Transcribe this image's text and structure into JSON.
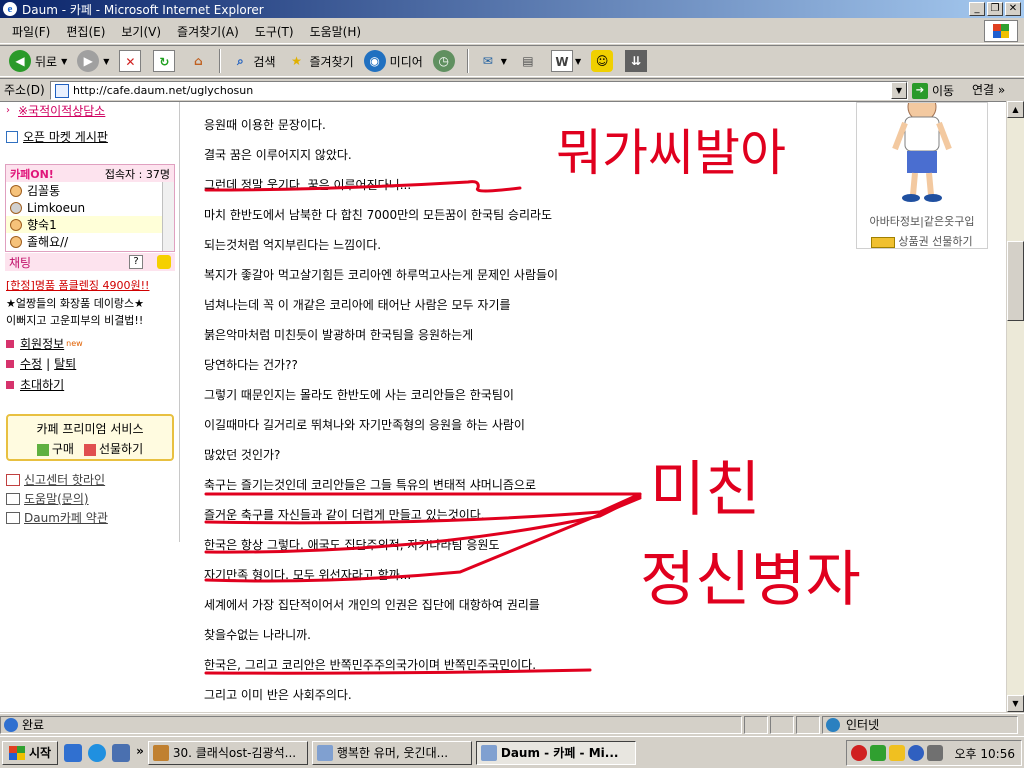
{
  "window": {
    "title": "Daum - 카페 - Microsoft Internet Explorer",
    "app_icon": "e"
  },
  "menu": [
    "파일(F)",
    "편집(E)",
    "보기(V)",
    "즐겨찾기(A)",
    "도구(T)",
    "도움말(H)"
  ],
  "toolbar": {
    "back": "뒤로",
    "search": "검색",
    "favorites": "즐겨찾기",
    "media": "미디어"
  },
  "address": {
    "label": "주소(D)",
    "url": "http://cafe.daum.net/uglychosun",
    "go": "이동",
    "links": "연결"
  },
  "sidebar": {
    "top_link": "※국적이적상담소",
    "open_market": "오픈 마켓 게시판",
    "cafe_on": {
      "label": "카페ON!",
      "visitors": "접속자 : 37명",
      "users": [
        "김꼴통",
        "Limkoeun",
        "향숙1",
        "졸해요//"
      ]
    },
    "chat": "채팅",
    "help_q": "?",
    "promo1": "[한정]명품 폼클렌징 4900원!!",
    "promo2": "★얼짱들의 화장품 데이랑스★",
    "promo3": "이뻐지고 고운피부의 비결법!!",
    "member_info": "회원정보",
    "new_tag": "new",
    "edit": "수정",
    "divider": "|",
    "leave": "탈퇴",
    "invite": "초대하기",
    "premium": {
      "title": "카페 프리미엄 서비스",
      "buy": "구매",
      "gift": "선물하기"
    },
    "report": "신고센터 핫라인",
    "help": "도움말(문의)",
    "terms": "Daum카페 약관"
  },
  "post_lines": [
    "응원때 이용한 문장이다.",
    "결국 꿈은 이루어지지 않았다.",
    "그런데 정말 웃기다. 꿈은 이루어진다니...",
    "마치 한반도에서 남북한 다 합친 7000만의 모든꿈이 한국팀 승리라도",
    "되는것처럼 억지부린다는 느낌이다.",
    "복지가 좋갈아 먹고살기힘든 코리아엔 하루먹고사는게 문제인 사람들이",
    "넘쳐나는데 꼭 이 개같은 코리아에 태어난 사람은 모두 자기를",
    "붉은악마처럼 미친듯이 발광하며 한국팀을 응원하는게",
    "당연하다는 건가??",
    "그렇기 때문인지는 몰라도 한반도에 사는 코리안들은 한국팀이",
    "이길때마다 길거리로 뛰쳐나와 자기만족형의 응원을 하는 사람이",
    "많았던 것인가?",
    "축구는 즐기는것인데 코리안들은 그들 특유의 변태적 샤머니즘으로",
    "즐거운 축구를 자신들과 같이 더럽게 만들고 있는것이다.",
    "한국은 항상 그렇다. 애국도 집단주의적, 자기나라팀 응원도",
    "자기만족 형이다. 모두 위선자라고 할까...",
    "세계에서 가장 집단적이어서 개인의 인권은 집단에 대항하여 권리를",
    "찾을수없는 나라니까.",
    "한국은, 그리고 코리안은 반쪽민주주의국가이며 반쪽민주국민이다.",
    "그리고 이미 반은 사회주의다."
  ],
  "handwriting": {
    "top": "뭐가씨발아",
    "mid": "미친",
    "bottom": "정신병자"
  },
  "avatar": {
    "info": "아바타정보",
    "sep": "|",
    "same_clothes": "같은옷구입",
    "gift_card": "상품권 선물하기"
  },
  "status": {
    "text": "완료",
    "zone": "인터넷"
  },
  "taskbar": {
    "start": "시작",
    "tasks": [
      "30. 클래식ost-김광석...",
      "행복한 유머, 웃긴대...",
      "Daum - 카페 - Mi..."
    ],
    "clock": "오후 10:56"
  },
  "colors": {
    "accent_pink": "#e0157a",
    "annotation_red": "#e0001e",
    "title_blue": "#0a246a"
  }
}
